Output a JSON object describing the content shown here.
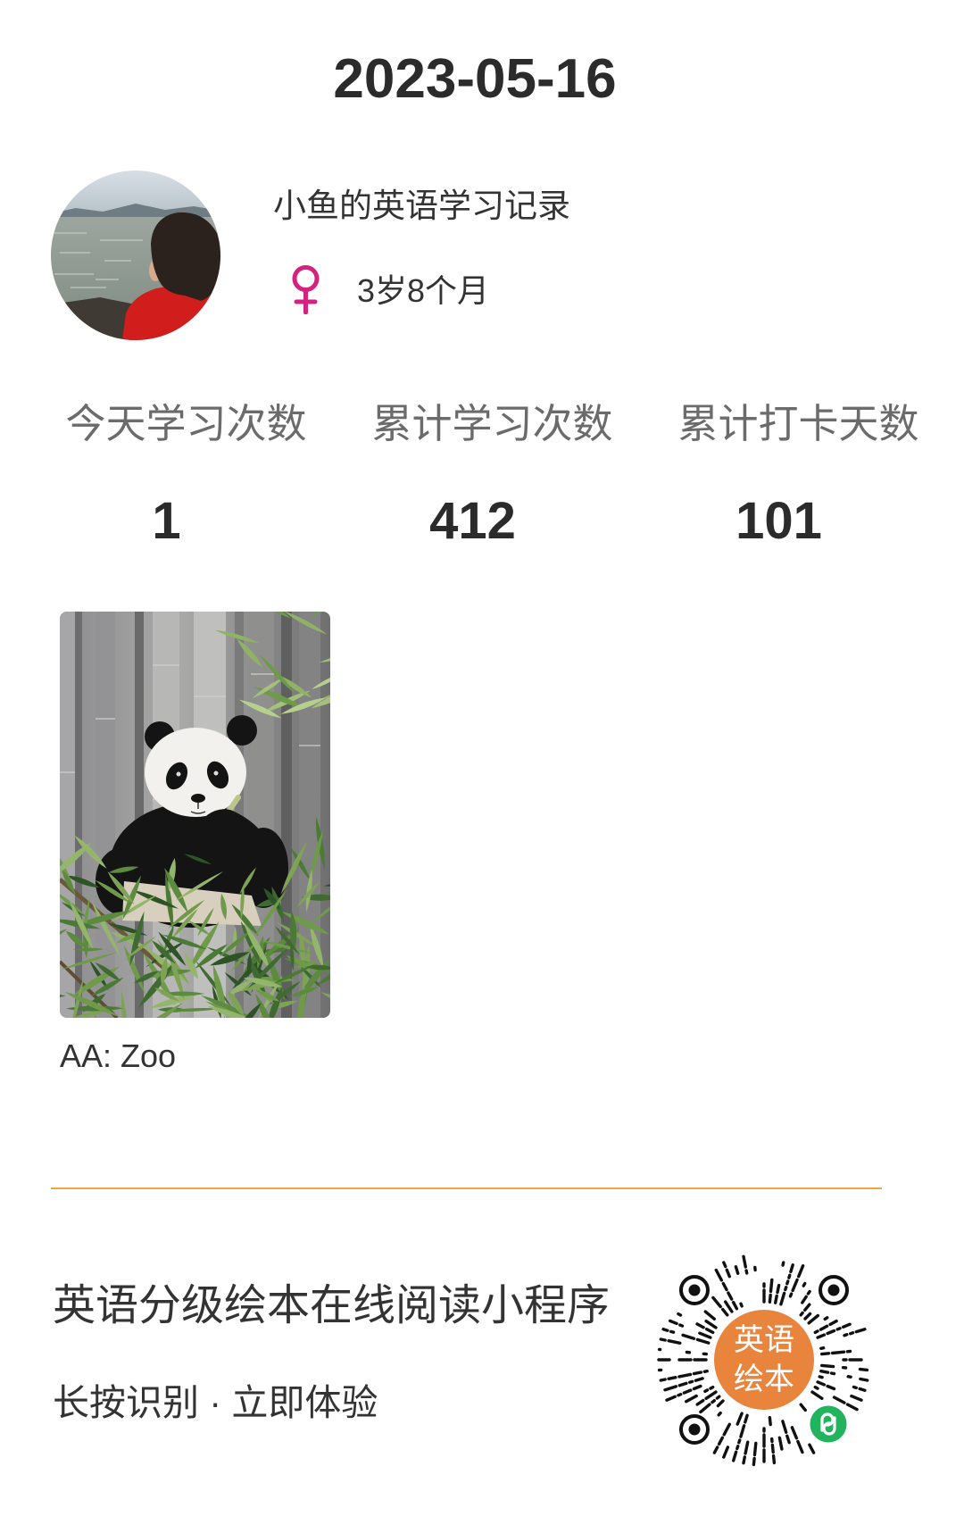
{
  "header": {
    "date": "2023-05-16"
  },
  "profile": {
    "avatar_icon": "avatar-photo",
    "name": "小鱼的英语学习记录",
    "gender_icon": "female-icon",
    "age": "3岁8个月"
  },
  "stats": [
    {
      "label": "今天学习次数",
      "value": 1
    },
    {
      "label": "累计学习次数",
      "value": 412
    },
    {
      "label": "累计打卡天数",
      "value": 101
    }
  ],
  "books": [
    {
      "title": "AA: Zoo",
      "cover_icon": "book-cover-photo"
    }
  ],
  "footer": {
    "title": "英语分级绘本在线阅读小程序",
    "subtitle": "长按识别 · 立即体验",
    "qr_code": {
      "icon": "mini-program-code",
      "center_label_line1": "英语",
      "center_label_line2": "绘本",
      "badge_icon": "mini-program-link-icon"
    }
  },
  "colors": {
    "text_primary": "#333333",
    "text_secondary": "#6b6b6b",
    "gender_female": "#d3237f",
    "divider": "#f0a33f",
    "qr_center": "#e8843b",
    "qr_badge": "#22b35e"
  }
}
